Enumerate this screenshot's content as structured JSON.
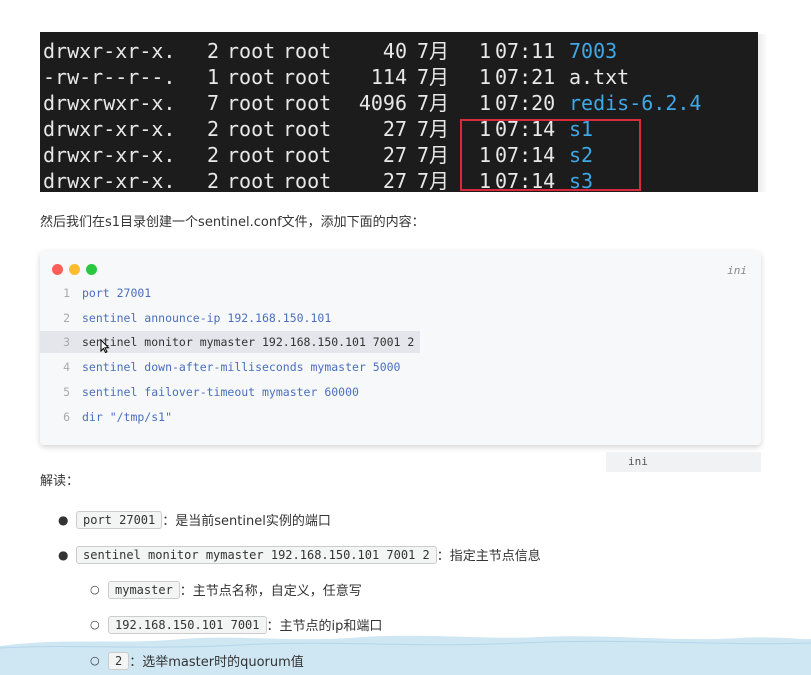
{
  "terminal": {
    "rows": [
      {
        "perm": "drwxr-xr-x.",
        "links": "2",
        "owner": "root",
        "group": "root",
        "size": "40",
        "month": "7月",
        "day": "1",
        "time": "07:11",
        "name": "7003",
        "is_dir": true
      },
      {
        "perm": "-rw-r--r--.",
        "links": "1",
        "owner": "root",
        "group": "root",
        "size": "114",
        "month": "7月",
        "day": "1",
        "time": "07:21",
        "name": "a.txt",
        "is_dir": false
      },
      {
        "perm": "drwxrwxr-x.",
        "links": "7",
        "owner": "root",
        "group": "root",
        "size": "4096",
        "month": "7月",
        "day": "1",
        "time": "07:20",
        "name": "redis-6.2.4",
        "is_dir": true
      },
      {
        "perm": "drwxr-xr-x.",
        "links": "2",
        "owner": "root",
        "group": "root",
        "size": "27",
        "month": "7月",
        "day": "1",
        "time": "07:14",
        "name": "s1",
        "is_dir": true
      },
      {
        "perm": "drwxr-xr-x.",
        "links": "2",
        "owner": "root",
        "group": "root",
        "size": "27",
        "month": "7月",
        "day": "1",
        "time": "07:14",
        "name": "s2",
        "is_dir": true
      },
      {
        "perm": "drwxr-xr-x.",
        "links": "2",
        "owner": "root",
        "group": "root",
        "size": "27",
        "month": "7月",
        "day": "1",
        "time": "07:14",
        "name": "s3",
        "is_dir": true
      }
    ]
  },
  "intro_text": "然后我们在s1目录创建一个sentinel.conf文件，添加下面的内容：",
  "code_block": {
    "language": "ini",
    "lines": [
      {
        "num": "1",
        "text": "port 27001"
      },
      {
        "num": "2",
        "text": "sentinel announce-ip 192.168.150.101"
      },
      {
        "num": "3",
        "text": "sentinel monitor mymaster 192.168.150.101 7001 2"
      },
      {
        "num": "4",
        "text": "sentinel down-after-milliseconds mymaster 5000"
      },
      {
        "num": "5",
        "text": "sentinel failover-timeout mymaster 60000"
      },
      {
        "num": "6",
        "text": "dir \"/tmp/s1\""
      }
    ],
    "highlighted_line": 3
  },
  "ini_bar_label": "ini",
  "explain_title": "解读：",
  "bullets": {
    "b1": {
      "code": "port 27001",
      "desc": "：是当前sentinel实例的端口"
    },
    "b2": {
      "code": "sentinel monitor mymaster 192.168.150.101 7001 2",
      "desc": "：指定主节点信息"
    },
    "b2_1": {
      "code": "mymaster",
      "desc": "：主节点名称，自定义，任意写"
    },
    "b2_2": {
      "code": "192.168.150.101 7001",
      "desc": "：主节点的ip和端口"
    },
    "b2_3": {
      "code": "2",
      "desc": "：选举master时的quorum值"
    }
  },
  "colors": {
    "terminal_bg": "#1c1c1c",
    "dir_name": "#3fa8e6",
    "highlight_box": "#d9293a",
    "code_text": "#4a6fbf",
    "wave": "#cfe6f3"
  }
}
